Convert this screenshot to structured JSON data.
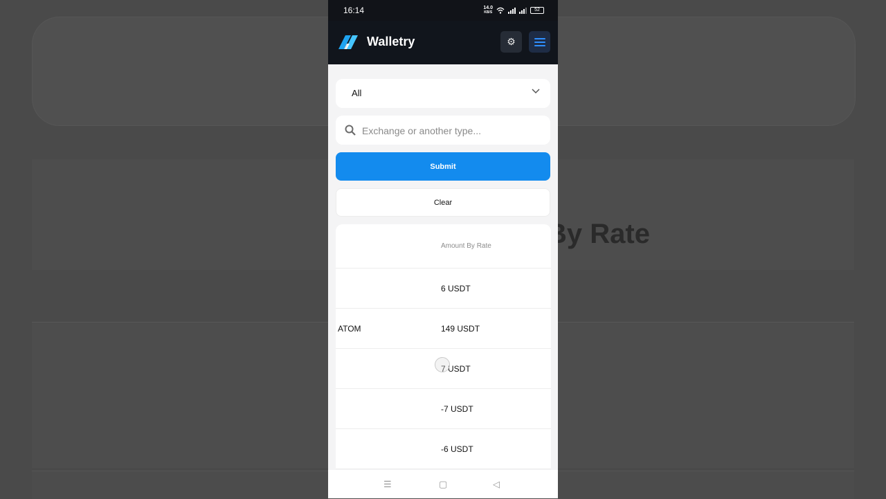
{
  "background": {
    "heading_fragment": "By Rate"
  },
  "status_bar": {
    "time": "16:14",
    "net_speed_value": "14.0",
    "net_speed_unit": "KB/S",
    "battery": "52"
  },
  "app": {
    "brand": "Walletry",
    "colors": {
      "accent": "#138bee",
      "topbar": "#11151c"
    }
  },
  "filters": {
    "type_select_value": "All",
    "search_placeholder": "Exchange or another type...",
    "submit_label": "Submit",
    "clear_label": "Clear"
  },
  "table": {
    "columns": [
      "",
      "Amount By Rate"
    ],
    "rows": [
      {
        "asset": "",
        "amount": "6 USDT"
      },
      {
        "asset": "ATOM",
        "amount": "149 USDT"
      },
      {
        "asset": "",
        "amount": "7 USDT"
      },
      {
        "asset": "",
        "amount": "-7 USDT"
      },
      {
        "asset": "",
        "amount": "-6 USDT"
      }
    ]
  },
  "nav_icons": [
    "menu-icon",
    "home-icon",
    "back-icon"
  ]
}
